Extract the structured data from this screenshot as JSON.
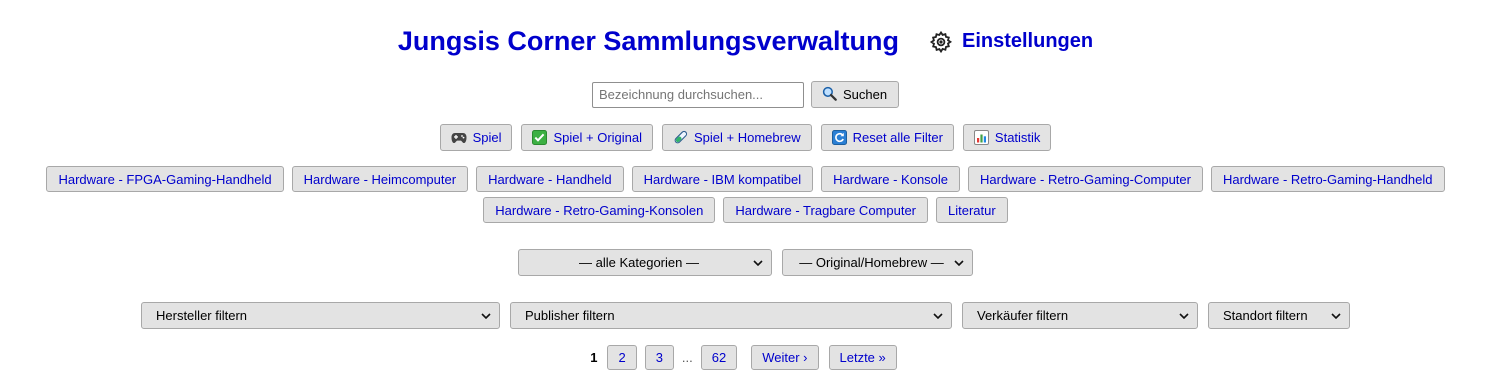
{
  "header": {
    "title": "Jungsis Corner Sammlungsverwaltung",
    "settings_label": "Einstellungen",
    "settings_icon": "gear-icon",
    "title_color": "#0000cc"
  },
  "search": {
    "placeholder": "Bezeichnung durchsuchen...",
    "value": "",
    "button_label": "Suchen",
    "button_icon": "magnifier-icon"
  },
  "filters": [
    {
      "label": "Spiel",
      "icon": "gamepad-icon"
    },
    {
      "label": "Spiel + Original",
      "icon": "checkmark-icon"
    },
    {
      "label": "Spiel + Homebrew",
      "icon": "test-tube-icon"
    },
    {
      "label": "Reset alle Filter",
      "icon": "refresh-icon"
    },
    {
      "label": "Statistik",
      "icon": "bar-chart-icon"
    }
  ],
  "hardware_categories": {
    "row1": [
      "Hardware - FPGA-Gaming-Handheld",
      "Hardware - Heimcomputer",
      "Hardware - Handheld",
      "Hardware - IBM kompatibel",
      "Hardware - Konsole",
      "Hardware - Retro-Gaming-Computer",
      "Hardware - Retro-Gaming-Handheld"
    ],
    "row2": [
      "Hardware - Retro-Gaming-Konsolen",
      "Hardware - Tragbare Computer",
      "Literatur"
    ]
  },
  "selects_primary": {
    "category": "— alle Kategorien —",
    "origin": "— Original/Homebrew —"
  },
  "selects_secondary": {
    "manufacturer": "Hersteller filtern",
    "publisher": "Publisher filtern",
    "seller": "Verkäufer filtern",
    "location": "Standort filtern"
  },
  "pagination": {
    "current": "1",
    "pages": [
      "2",
      "3"
    ],
    "ellipsis": "...",
    "last_page": "62",
    "next_label": "Weiter ›",
    "last_label": "Letzte »"
  }
}
